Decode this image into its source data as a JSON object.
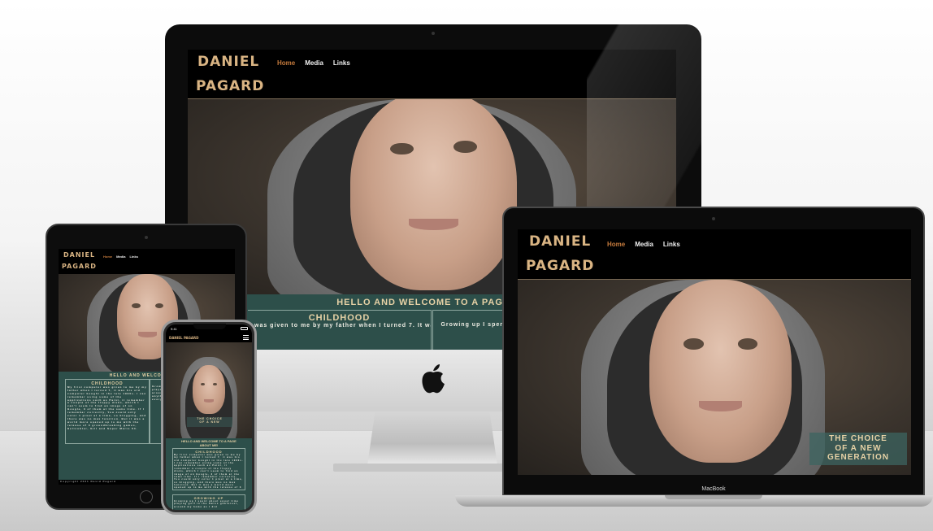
{
  "site": {
    "logo_line1": "DANIEL",
    "logo_line2": "PAGARD",
    "nav": {
      "home": "Home",
      "media": "Media",
      "links": "Links"
    },
    "welcome_desktop": "HELLO AND WELCOME TO A PAGE AB",
    "welcome_tablet": "HELLO AND WELCOME TO A",
    "welcome_phone_1": "HELLO AND WELCOME TO A PAGE",
    "welcome_phone_2": "ABOUT ME!",
    "childhood_title": "CHILDHOOD",
    "childhood_desktop_text": "was given to me by my father when I turned 7. It was his old",
    "growing_desktop_text": "Growing up I spent abou",
    "growing_title": "GROWING UP",
    "growing_phone_text": "Growing up I spent about equal time playing golf in the Swiss gubforest, around my home as I did",
    "choice_line1": "THE CHOICE",
    "choice_line2": "OF A NEW",
    "choice_line3": "GENERATION",
    "phone_status_time": "9:41",
    "footer_copyright": "Copyright 2021 David Pagard",
    "small_body_text": "My first computer was given to me by my father when I turned 7, it was his old computer bought in the late 1990s. I can remember using some of the applications such as Paint, it remember a couple of the floppy disks, which I can't seem to find an image of on Google, 3 of them at the same time. If I remember correctly, You could only color 1 pixel at a time, so blogging, and there was no max function. But it was a world more opened up to me with the release of 3 groundbreaking games, Helicobter, Gill and Super Mario 64.",
    "small_body_text_right": "Growing up I spent about equal time playing golf in the Swiss golfforest, around my home as I did programming anything I could, I thought about everything from the outdoors"
  },
  "devices": {
    "laptop_label": "MacBook"
  },
  "colors": {
    "accent_gold": "#d9b483",
    "nav_home": "#c47a3c",
    "teal_band": "#2d4f4a",
    "site_bg": "#000000"
  }
}
